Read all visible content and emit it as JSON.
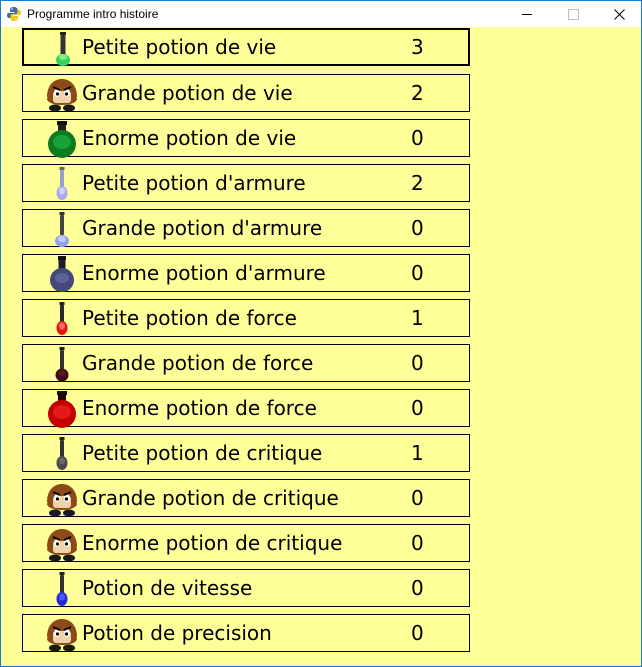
{
  "window": {
    "title": "Programme intro histoire",
    "background": "#ffff99"
  },
  "items": [
    {
      "label": "Petite potion de vie",
      "count": "3",
      "icon": "potion-small-green-icon",
      "selected": true
    },
    {
      "label": "Grande potion de vie",
      "count": "2",
      "icon": "goomba-icon"
    },
    {
      "label": "Enorme potion de vie",
      "count": "0",
      "icon": "potion-huge-green-icon"
    },
    {
      "label": "Petite potion d'armure",
      "count": "2",
      "icon": "potion-small-lavender-icon"
    },
    {
      "label": "Grande potion d'armure",
      "count": "0",
      "icon": "potion-large-blue-icon"
    },
    {
      "label": "Enorme potion d'armure",
      "count": "0",
      "icon": "potion-huge-navy-icon"
    },
    {
      "label": "Petite potion de force",
      "count": "1",
      "icon": "potion-small-red-icon"
    },
    {
      "label": "Grande potion de force",
      "count": "0",
      "icon": "potion-large-darkred-icon"
    },
    {
      "label": "Enorme potion de force",
      "count": "0",
      "icon": "potion-huge-red-icon"
    },
    {
      "label": "Petite potion de critique",
      "count": "1",
      "icon": "potion-small-gray-icon"
    },
    {
      "label": "Grande potion de critique",
      "count": "0",
      "icon": "goomba-icon"
    },
    {
      "label": "Enorme potion de critique",
      "count": "0",
      "icon": "goomba-icon"
    },
    {
      "label": "Potion de vitesse",
      "count": "0",
      "icon": "potion-small-blue-icon"
    },
    {
      "label": "Potion de precision",
      "count": "0",
      "icon": "goomba-icon"
    }
  ]
}
